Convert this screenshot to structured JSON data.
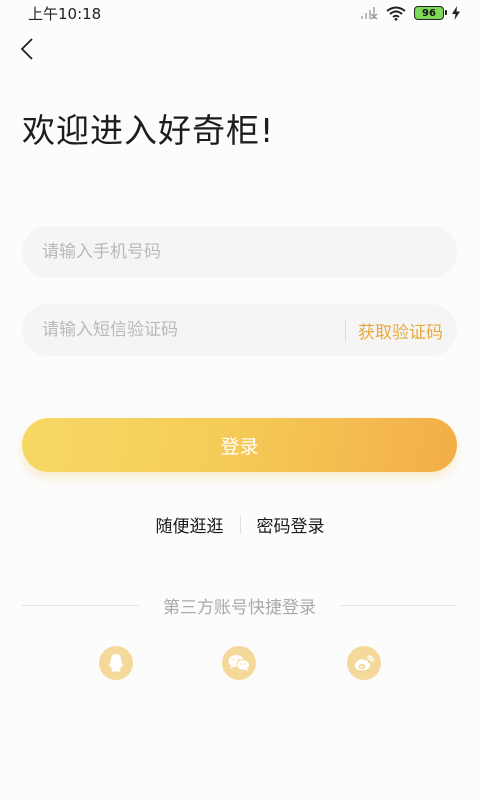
{
  "status_bar": {
    "time": "上午10:18",
    "battery": "96"
  },
  "page": {
    "title": "欢迎进入好奇柜!"
  },
  "form": {
    "phone_placeholder": "请输入手机号码",
    "code_placeholder": "请输入短信验证码",
    "get_code_label": "获取验证码",
    "login_label": "登录"
  },
  "links": {
    "browse_label": "随便逛逛",
    "password_login_label": "密码登录"
  },
  "third_party": {
    "label": "第三方账号快捷登录",
    "icons": [
      "qq-icon",
      "wechat-icon",
      "weibo-icon"
    ]
  },
  "colors": {
    "accent": "#e9a93a",
    "button_start": "#f7d865",
    "button_end": "#f3ae48",
    "social_bg": "#f5d99a"
  }
}
